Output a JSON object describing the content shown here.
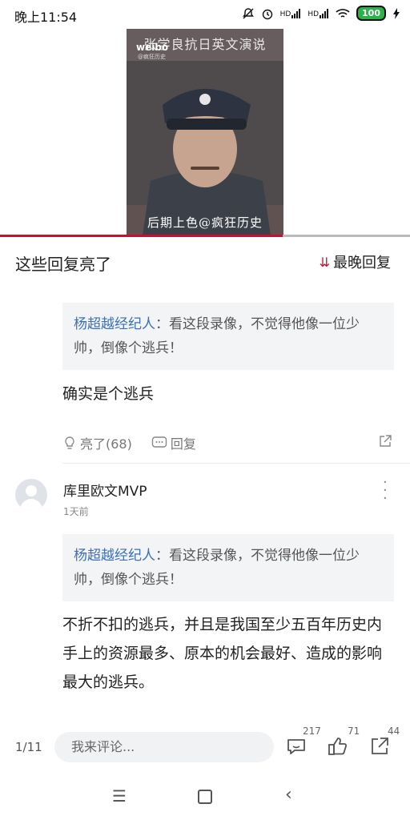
{
  "status_bar": {
    "time": "晚上11:54",
    "battery": "100",
    "sig1": "HD",
    "sig2": "HD"
  },
  "video": {
    "title_overlay": "张学良抗日英文演说",
    "watermark": "weibo",
    "watermark_sub": "@疯狂历史",
    "caption": "后期上色@疯狂历史",
    "progress": 0.69
  },
  "section": {
    "title": "这些回复亮了",
    "sort_label": "最晚回复"
  },
  "reply1": {
    "quote_user": "杨超越经纪人",
    "quote_text": "：看这段录像，不觉得他像一位少帅，倒像个逃兵！",
    "text": "确实是个逃兵",
    "like_label": "亮了(68)",
    "reply_label": "回复"
  },
  "comment2": {
    "username": "库里欧文MVP",
    "time": "1天前",
    "quote_user": "杨超越经纪人",
    "quote_text": "：看这段录像，不觉得他像一位少帅，倒像个逃兵！",
    "text": "不折不扣的逃兵，并且是我国至少五百年历史内手上的资源最多、原本的机会最好、造成的影响最大的逃兵。"
  },
  "bottom_bar": {
    "page": "1/11",
    "input_placeholder": "我来评论...",
    "comment_count": "217",
    "like_count": "71",
    "share_count": "44"
  },
  "icons": [
    "mute-icon",
    "alarm-icon",
    "signal-icon",
    "wifi-icon",
    "battery-icon",
    "charging-icon",
    "sort-icon",
    "bulb-icon",
    "reply-icon",
    "share-icon",
    "more-icon",
    "comment-icon",
    "thumb-up-icon",
    "nav-menu-icon",
    "nav-home-icon",
    "nav-back-icon"
  ]
}
